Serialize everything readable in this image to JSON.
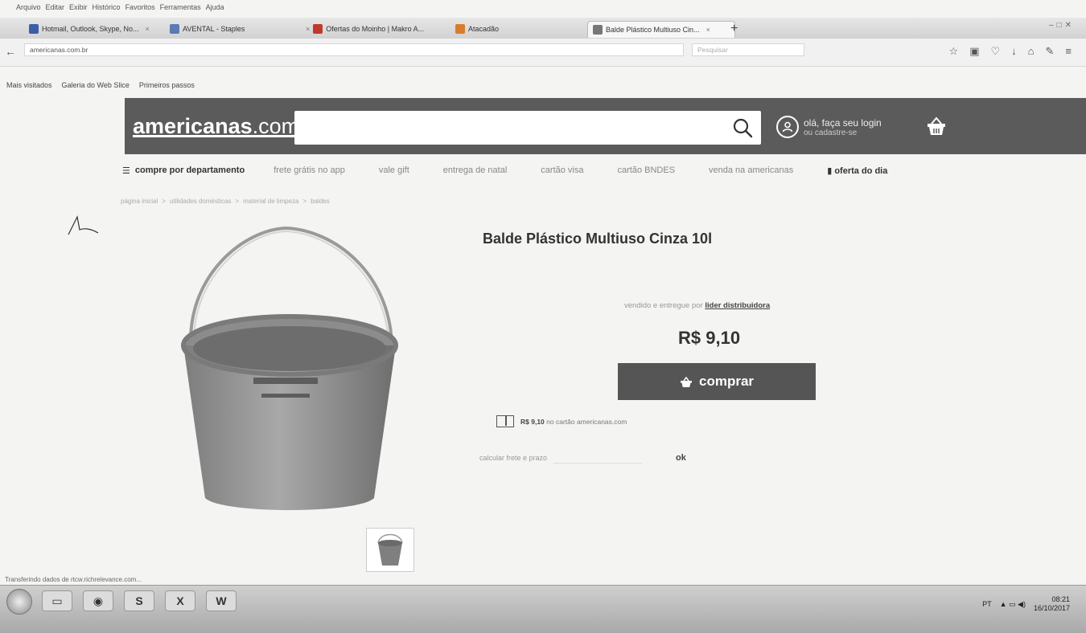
{
  "browser": {
    "menu": [
      "Arquivo",
      "Editar",
      "Exibir",
      "Histórico",
      "Favoritos",
      "Ferramentas",
      "Ajuda"
    ],
    "tabs": [
      {
        "label": "Hotmail, Outlook, Skype, No...",
        "color": "#3a5fa8"
      },
      {
        "label": "AVENTAL - Staples",
        "color": "#5c7ab3"
      },
      {
        "label": "Ofertas do Moinho | Makro A...",
        "color": "#c0392b"
      },
      {
        "label": "Atacadão",
        "color": "#d97c2b"
      },
      {
        "label": "Balde Plástico Multiuso Cin...",
        "color": "#777777"
      }
    ],
    "url": "americanas.com.br",
    "search_placeholder": "Pesquisar",
    "bookmarks": [
      "Mais visitados",
      "Galeria do Web Slice",
      "Primeiros passos"
    ]
  },
  "site": {
    "logo": {
      "main": "americanas",
      "suffix": ".com"
    },
    "account": {
      "line1": "olá, faça seu login",
      "line2": "ou cadastre-se"
    },
    "nav": {
      "department": "compre por departamento",
      "items": [
        "frete grátis no app",
        "vale gift",
        "entrega de natal",
        "cartão visa",
        "cartão BNDES",
        "venda na americanas"
      ],
      "offer": "oferta do dia"
    },
    "breadcrumb": [
      "página inicial",
      "utilidades domésticas",
      "material de limpeza",
      "baldes"
    ]
  },
  "product": {
    "title": "Balde Plástico Multiuso Cinza 10l",
    "seller_prefix": "vendido e entregue por",
    "seller": "lider distribuidora",
    "price": "R$ 9,10",
    "buy_label": "comprar",
    "card_price": "R$ 9,10",
    "card_text": "no cartão americanas.com",
    "freight_label": "calcular frete e prazo",
    "freight_ok": "ok"
  },
  "statusbar": "Transferindo dados de rtcw.richrelevance.com...",
  "taskbar": {
    "apps": [
      "explorer",
      "chrome",
      "skype",
      "excel",
      "word"
    ],
    "tray_lang": "PT",
    "time": "08:21",
    "date": "16/10/2017"
  },
  "colors": {
    "header": "#5b5b5b",
    "button": "#555555",
    "page_bg": "#f4f4f2"
  }
}
